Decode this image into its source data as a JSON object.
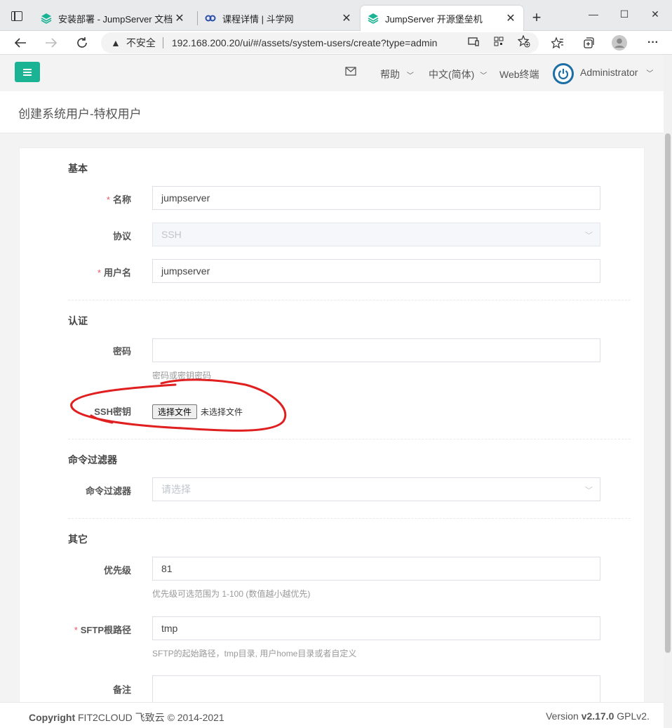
{
  "browser": {
    "tabs": [
      {
        "title": "安装部署 - JumpServer 文档",
        "favicon": "jumpserver-layers-icon"
      },
      {
        "title": "课程详情 | 斗学网",
        "favicon": "link-icon"
      },
      {
        "title": "JumpServer 开源堡垒机",
        "favicon": "jumpserver-layers-icon",
        "active": true
      }
    ],
    "security_label": "不安全",
    "url": "192.168.200.20/ui/#/assets/system-users/create?type=admin"
  },
  "header": {
    "help": "帮助",
    "language": "中文(简体)",
    "web_terminal": "Web终端",
    "user": "Administrator"
  },
  "page": {
    "title": "创建系统用户-特权用户"
  },
  "form": {
    "basic": {
      "section": "基本",
      "name_label": "名称",
      "name_value": "jumpserver",
      "protocol_label": "协议",
      "protocol_value": "SSH",
      "username_label": "用户名",
      "username_value": "jumpserver"
    },
    "auth": {
      "section": "认证",
      "password_label": "密码",
      "password_help": "密码或密钥密码",
      "ssh_key_label": "SSH密钥",
      "file_button": "选择文件",
      "file_none": "未选择文件"
    },
    "filter": {
      "section": "命令过滤器",
      "label": "命令过滤器",
      "placeholder": "请选择"
    },
    "other": {
      "section": "其它",
      "priority_label": "优先级",
      "priority_value": "81",
      "priority_help": "优先级可选范围为 1-100 (数值越小越优先)",
      "sftp_label": "SFTP根路径",
      "sftp_value": "tmp",
      "sftp_help": "SFTP的起始路径，tmp目录, 用户home目录或者自定义",
      "comment_label": "备注"
    }
  },
  "footer": {
    "copyright_prefix": "Copyright",
    "copyright_rest": "FIT2CLOUD 飞致云 © 2014-2021",
    "version_prefix": "Version",
    "version": "v2.17.0",
    "license": "GPLv2."
  },
  "colors": {
    "accent": "#1ab394",
    "required": "#ed5565",
    "annotation": "#e02020"
  }
}
